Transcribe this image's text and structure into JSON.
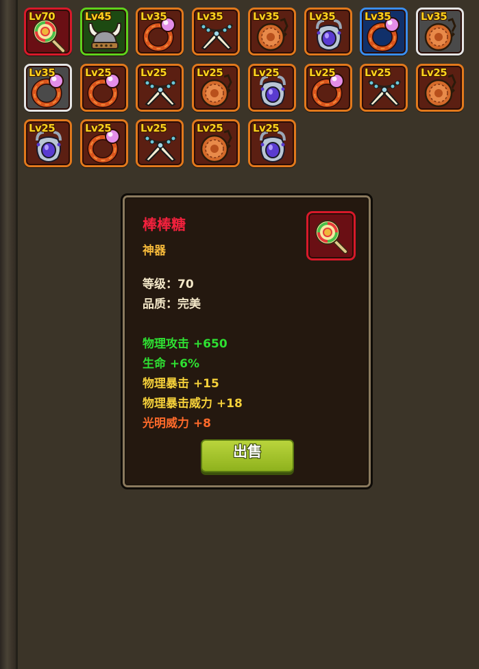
{
  "inventory": {
    "slots": [
      {
        "level": "Lv70",
        "item": "lollipop-icon",
        "rarity": "red"
      },
      {
        "level": "Lv45",
        "item": "viking-helmet-icon",
        "rarity": "green"
      },
      {
        "level": "Lv35",
        "item": "pearl-bracelet-icon",
        "rarity": "orange"
      },
      {
        "level": "Lv35",
        "item": "fang-necklace-icon",
        "rarity": "orange"
      },
      {
        "level": "Lv35",
        "item": "orange-pouch-icon",
        "rarity": "orange"
      },
      {
        "level": "Lv35",
        "item": "gem-amulet-icon",
        "rarity": "orange"
      },
      {
        "level": "Lv35",
        "item": "pearl-bracelet-icon",
        "rarity": "blue"
      },
      {
        "level": "Lv35",
        "item": "orange-pouch-icon",
        "rarity": "white"
      },
      {
        "level": "Lv35",
        "item": "pearl-bracelet-icon",
        "rarity": "white"
      },
      {
        "level": "Lv25",
        "item": "pearl-bracelet-icon",
        "rarity": "orange"
      },
      {
        "level": "Lv25",
        "item": "fang-necklace-icon",
        "rarity": "orange"
      },
      {
        "level": "Lv25",
        "item": "orange-pouch-icon",
        "rarity": "orange"
      },
      {
        "level": "Lv25",
        "item": "gem-amulet-icon",
        "rarity": "orange"
      },
      {
        "level": "Lv25",
        "item": "pearl-bracelet-icon",
        "rarity": "orange"
      },
      {
        "level": "Lv25",
        "item": "fang-necklace-icon",
        "rarity": "orange"
      },
      {
        "level": "Lv25",
        "item": "orange-pouch-icon",
        "rarity": "orange"
      },
      {
        "level": "Lv25",
        "item": "gem-amulet-icon",
        "rarity": "orange"
      },
      {
        "level": "Lv25",
        "item": "pearl-bracelet-icon",
        "rarity": "orange"
      },
      {
        "level": "Lv25",
        "item": "fang-necklace-icon",
        "rarity": "orange"
      },
      {
        "level": "Lv25",
        "item": "orange-pouch-icon",
        "rarity": "orange"
      },
      {
        "level": "Lv25",
        "item": "gem-amulet-icon",
        "rarity": "orange"
      }
    ]
  },
  "tooltip": {
    "name": "棒棒糖",
    "type": "神器",
    "level_line": "等级：70",
    "quality_line": "品质：完美",
    "icon": "lollipop-icon",
    "stats": [
      {
        "text": "物理攻击 +650",
        "color": "green"
      },
      {
        "text": "生命 +6%",
        "color": "green"
      },
      {
        "text": "物理暴击 +15",
        "color": "yellow"
      },
      {
        "text": "物理暴击威力 +18",
        "color": "yellow"
      },
      {
        "text": "光明威力 +8",
        "color": "orange"
      }
    ],
    "sell_label": "出售"
  },
  "colors": {
    "rarity_red": "#d8192a",
    "rarity_green": "#5fd21c",
    "rarity_blue": "#3a8ef0",
    "rarity_white": "#e6e6e6",
    "rarity_orange": "#e2791c",
    "stat_green": "#2ee032",
    "stat_yellow": "#f5d03a",
    "stat_orange": "#ff6a2a",
    "name_red": "#f2213d",
    "type_gold": "#f5b93a"
  }
}
